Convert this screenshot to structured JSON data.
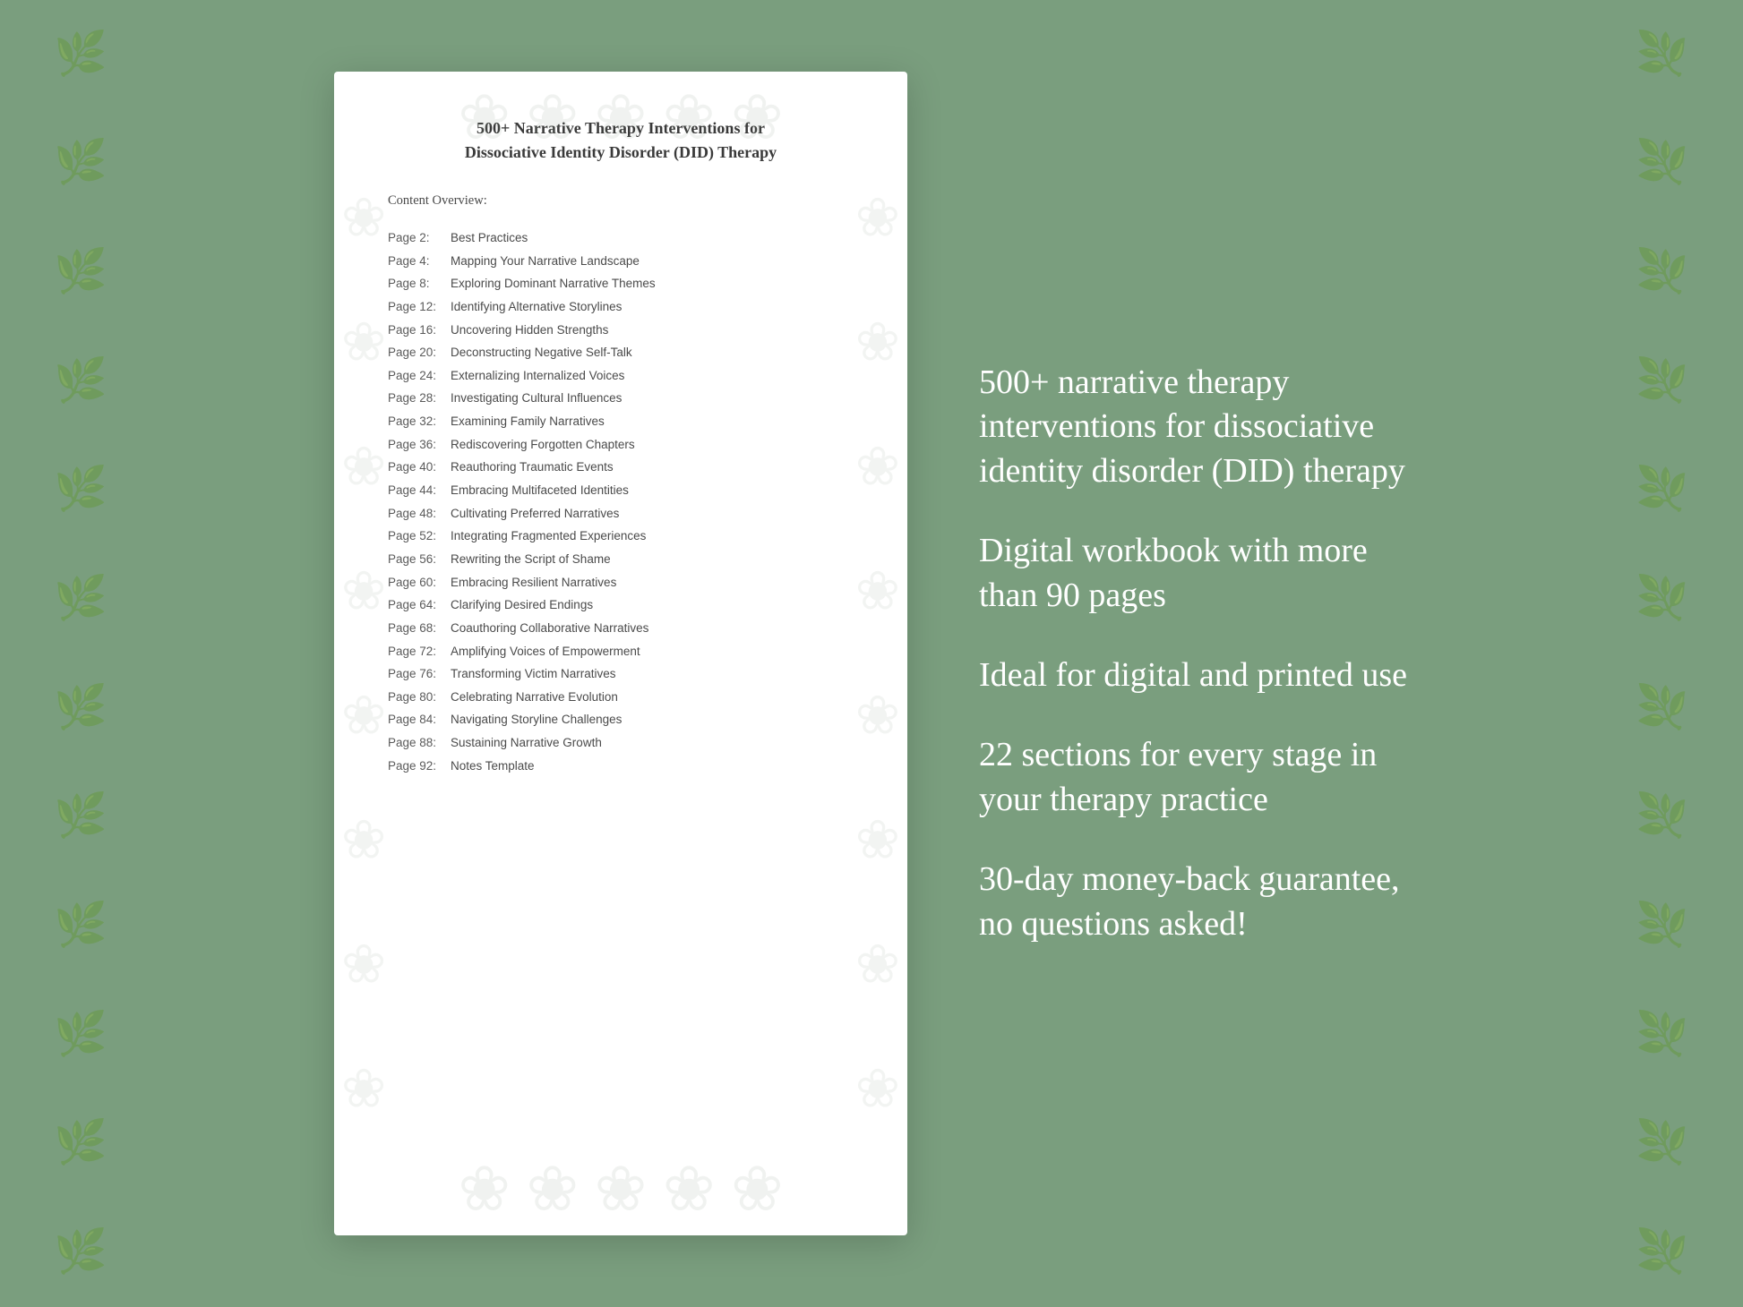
{
  "page": {
    "bg_color": "#7a9e7e"
  },
  "document": {
    "title_line1": "500+ Narrative Therapy Interventions for",
    "title_line2": "Dissociative Identity Disorder (DID) Therapy",
    "toc_heading": "Content Overview:",
    "toc_items": [
      {
        "page": "Page  2:",
        "title": "Best Practices"
      },
      {
        "page": "Page  4:",
        "title": "Mapping Your Narrative Landscape"
      },
      {
        "page": "Page  8:",
        "title": "Exploring Dominant Narrative Themes"
      },
      {
        "page": "Page 12:",
        "title": "Identifying Alternative Storylines"
      },
      {
        "page": "Page 16:",
        "title": "Uncovering Hidden Strengths"
      },
      {
        "page": "Page 20:",
        "title": "Deconstructing Negative Self-Talk"
      },
      {
        "page": "Page 24:",
        "title": "Externalizing Internalized Voices"
      },
      {
        "page": "Page 28:",
        "title": "Investigating Cultural Influences"
      },
      {
        "page": "Page 32:",
        "title": "Examining Family Narratives"
      },
      {
        "page": "Page 36:",
        "title": "Rediscovering Forgotten Chapters"
      },
      {
        "page": "Page 40:",
        "title": "Reauthoring Traumatic Events"
      },
      {
        "page": "Page 44:",
        "title": "Embracing Multifaceted Identities"
      },
      {
        "page": "Page 48:",
        "title": "Cultivating Preferred Narratives"
      },
      {
        "page": "Page 52:",
        "title": "Integrating Fragmented Experiences"
      },
      {
        "page": "Page 56:",
        "title": "Rewriting the Script of Shame"
      },
      {
        "page": "Page 60:",
        "title": "Embracing Resilient Narratives"
      },
      {
        "page": "Page 64:",
        "title": "Clarifying Desired Endings"
      },
      {
        "page": "Page 68:",
        "title": "Coauthoring Collaborative Narratives"
      },
      {
        "page": "Page 72:",
        "title": "Amplifying Voices of Empowerment"
      },
      {
        "page": "Page 76:",
        "title": "Transforming Victim Narratives"
      },
      {
        "page": "Page 80:",
        "title": "Celebrating Narrative Evolution"
      },
      {
        "page": "Page 84:",
        "title": "Navigating Storyline Challenges"
      },
      {
        "page": "Page 88:",
        "title": "Sustaining Narrative Growth"
      },
      {
        "page": "Page 92:",
        "title": "Notes Template"
      }
    ]
  },
  "features": [
    "500+ narrative therapy interventions for dissociative identity disorder (DID) therapy",
    "Digital workbook with more than 90 pages",
    "Ideal for digital and printed use",
    "22 sections for every stage in your therapy practice",
    "30-day money-back guarantee, no questions asked!"
  ],
  "icons": {
    "floral": "❧",
    "watermark": "❀"
  }
}
